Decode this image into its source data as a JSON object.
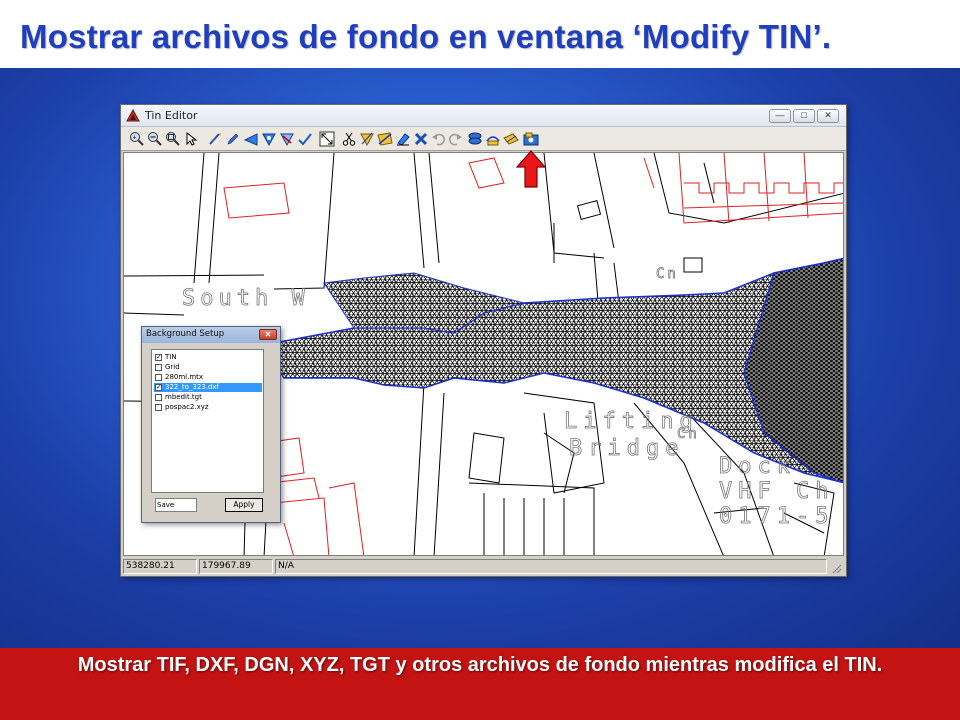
{
  "slide": {
    "title": "Mostrar archivos de fondo en ventana ‘Modify TIN’.",
    "footer": "Mostrar TIF, DXF, DGN, XYZ, TGT y otros archivos de fondo mientras modifica el TIN.",
    "colors": {
      "title": "#1f3fc0",
      "footer_band": "#c31313",
      "background": "#2a5fd0"
    }
  },
  "tin_editor": {
    "title": "Tin Editor",
    "window_buttons": [
      "minimize-icon",
      "maximize-icon",
      "close-icon"
    ],
    "toolbar_icons": [
      "zoom-in-icon",
      "zoom-out-icon",
      "zoom-window-icon",
      "select-arrow-icon",
      "draw-line-icon",
      "edit-pencil-icon",
      "flip-triangle-icon",
      "fill-triangle-icon",
      "delete-triangle-icon",
      "check-edit-icon",
      "zoom-extents-icon",
      "cut-icon",
      "insert-point-icon",
      "add-breakline-icon",
      "erase-icon",
      "delete-x-icon",
      "undo-icon",
      "redo-icon",
      "layers-icon",
      "background-files-icon",
      "import-icon",
      "background-setup-icon"
    ],
    "map_labels": [
      "South W",
      "Lifting",
      "Bridge",
      "Dock",
      "VHF Ch",
      "0171-5",
      "Cn",
      "Cn"
    ],
    "status": {
      "easting": "538280.21",
      "northing": "179967.89",
      "value": "N/A"
    },
    "colors": {
      "tin_mesh": "#000000",
      "tin_boundary": "#1a2fd0",
      "map_lines": "#e02020"
    }
  },
  "background_setup": {
    "title": "Background Setup",
    "items": [
      {
        "label": "TIN",
        "checked": true,
        "selected": false
      },
      {
        "label": "Grid",
        "checked": false,
        "selected": false
      },
      {
        "label": "280ml.mtx",
        "checked": false,
        "selected": false
      },
      {
        "label": "322_to_323.dxf",
        "checked": true,
        "selected": true
      },
      {
        "label": "mbedit.tgt",
        "checked": false,
        "selected": false
      },
      {
        "label": "pospac2.xyz",
        "checked": false,
        "selected": false
      }
    ],
    "save_label": "Save Repor",
    "apply_label": "Apply"
  },
  "annotation": {
    "pointer": "red-up-arrow-icon"
  }
}
